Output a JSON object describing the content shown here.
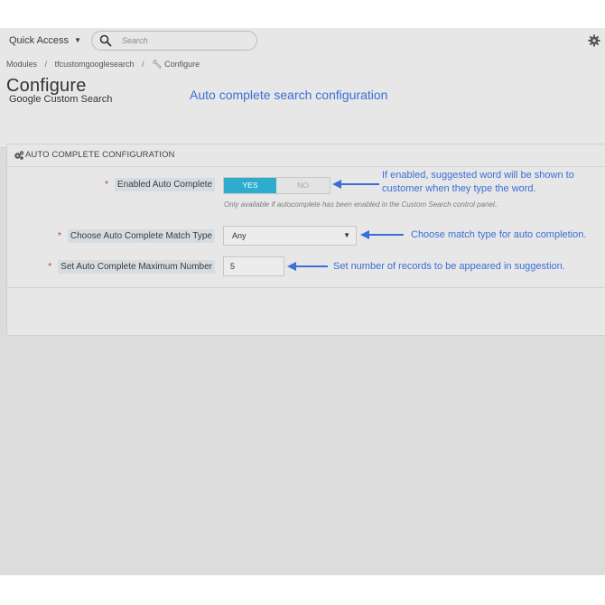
{
  "topbar": {
    "quick_access": "Quick Access",
    "search_placeholder": "Search"
  },
  "breadcrumb": {
    "items": [
      "Modules",
      "tfcustomgooglesearch",
      "Configure"
    ],
    "separator": "/"
  },
  "page": {
    "title": "Configure",
    "subtitle": "Google Custom Search"
  },
  "annotations": {
    "header": "Auto complete search configuration",
    "enabled_line1": "If enabled, suggested word will be shown to",
    "enabled_line2": "customer when they type the word.",
    "match_type": "Choose match type for auto completion.",
    "max_number": "Set number of records to be appeared in suggestion."
  },
  "panel": {
    "heading": "AUTO COMPLETE CONFIGURATION",
    "fields": {
      "enabled": {
        "required": "*",
        "label": "Enabled Auto Complete",
        "yes": "YES",
        "no": "NO",
        "value": "YES",
        "help": "Only available if autocomplete has been enabled in the Custom Search control panel.."
      },
      "match_type": {
        "required": "*",
        "label": "Choose Auto Complete Match Type",
        "value": "Any"
      },
      "max_number": {
        "required": "*",
        "label": "Set Auto Complete Maximum Number",
        "value": "5"
      }
    }
  },
  "colors": {
    "accent": "#2eacce",
    "annotation": "#3a6fd6",
    "required": "#c0392b"
  },
  "icons": [
    "search-icon",
    "gear-icon",
    "wrench-icon",
    "cogs-icon",
    "caret-down-icon"
  ]
}
